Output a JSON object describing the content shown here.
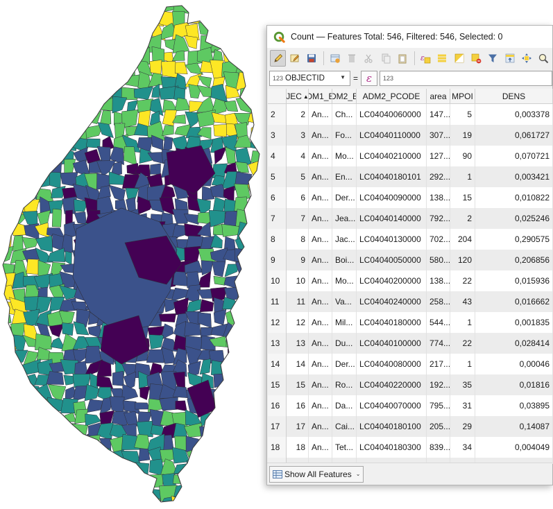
{
  "window": {
    "title": "Count — Features Total: 546, Filtered: 546, Selected: 0"
  },
  "toolbar": {
    "buttons": [
      {
        "icon": "pencil-icon",
        "name": "toggle-editing"
      },
      {
        "icon": "multi-edit-icon",
        "name": "multi-edit"
      },
      {
        "icon": "save-edits-icon",
        "name": "save-edits"
      },
      {
        "icon": "add-feature-icon",
        "name": "add-feature"
      },
      {
        "icon": "delete-icon",
        "name": "delete-features"
      },
      {
        "icon": "cut-icon",
        "name": "cut"
      },
      {
        "icon": "copy-icon",
        "name": "copy"
      },
      {
        "icon": "paste-icon",
        "name": "paste"
      },
      {
        "icon": "expression-select-icon",
        "name": "select-by-expression"
      },
      {
        "icon": "select-all-icon",
        "name": "select-all"
      },
      {
        "icon": "invert-selection-icon",
        "name": "invert-selection"
      },
      {
        "icon": "deselect-icon",
        "name": "deselect-all"
      },
      {
        "icon": "filter-icon",
        "name": "filter-select"
      },
      {
        "icon": "move-to-top-icon",
        "name": "move-selection-top"
      },
      {
        "icon": "pan-to-selected-icon",
        "name": "pan-to-selected"
      },
      {
        "icon": "zoom-icon",
        "name": "zoom-to-selected"
      }
    ]
  },
  "filter": {
    "field_type": "123",
    "field": "OBJECTID",
    "operator": "=",
    "expression_symbol": "ε",
    "value_placeholder": "123"
  },
  "table": {
    "columns": [
      "JEC",
      "DM1_E",
      "DM2_E",
      "ADM2_PCODE",
      "area",
      "MPOI",
      "DENS"
    ],
    "sort_indicator": "▲",
    "rows": [
      {
        "n": "2",
        "oid": "2",
        "adm1": "An...",
        "adm2": "Ch...",
        "pcode": "LC04040060000",
        "area": "147...",
        "mpoi": "5",
        "dens": "0,003378"
      },
      {
        "n": "3",
        "oid": "3",
        "adm1": "An...",
        "adm2": "Fo...",
        "pcode": "LC04040110000",
        "area": "307...",
        "mpoi": "19",
        "dens": "0,061727"
      },
      {
        "n": "4",
        "oid": "4",
        "adm1": "An...",
        "adm2": "Mo...",
        "pcode": "LC04040210000",
        "area": "127...",
        "mpoi": "90",
        "dens": "0,070721"
      },
      {
        "n": "5",
        "oid": "5",
        "adm1": "An...",
        "adm2": "En...",
        "pcode": "LC04040180101",
        "area": "292...",
        "mpoi": "1",
        "dens": "0,003421"
      },
      {
        "n": "6",
        "oid": "6",
        "adm1": "An...",
        "adm2": "Der...",
        "pcode": "LC04040090000",
        "area": "138...",
        "mpoi": "15",
        "dens": "0,010822"
      },
      {
        "n": "7",
        "oid": "7",
        "adm1": "An...",
        "adm2": "Jea...",
        "pcode": "LC04040140000",
        "area": "792...",
        "mpoi": "2",
        "dens": "0,025246"
      },
      {
        "n": "8",
        "oid": "8",
        "adm1": "An...",
        "adm2": "Jac...",
        "pcode": "LC04040130000",
        "area": "702...",
        "mpoi": "204",
        "dens": "0,290575"
      },
      {
        "n": "9",
        "oid": "9",
        "adm1": "An...",
        "adm2": "Boi...",
        "pcode": "LC04040050000",
        "area": "580...",
        "mpoi": "120",
        "dens": "0,206856"
      },
      {
        "n": "10",
        "oid": "10",
        "adm1": "An...",
        "adm2": "Mo...",
        "pcode": "LC04040200000",
        "area": "138...",
        "mpoi": "22",
        "dens": "0,015936"
      },
      {
        "n": "11",
        "oid": "11",
        "adm1": "An...",
        "adm2": "Va...",
        "pcode": "LC04040240000",
        "area": "258...",
        "mpoi": "43",
        "dens": "0,016662"
      },
      {
        "n": "12",
        "oid": "12",
        "adm1": "An...",
        "adm2": "Mil...",
        "pcode": "LC04040180000",
        "area": "544...",
        "mpoi": "1",
        "dens": "0,001835"
      },
      {
        "n": "13",
        "oid": "13",
        "adm1": "An...",
        "adm2": "Du...",
        "pcode": "LC04040100000",
        "area": "774...",
        "mpoi": "22",
        "dens": "0,028414"
      },
      {
        "n": "14",
        "oid": "14",
        "adm1": "An...",
        "adm2": "Der...",
        "pcode": "LC04040080000",
        "area": "217...",
        "mpoi": "1",
        "dens": "0,00046"
      },
      {
        "n": "15",
        "oid": "15",
        "adm1": "An...",
        "adm2": "Ro...",
        "pcode": "LC04040220000",
        "area": "192...",
        "mpoi": "35",
        "dens": "0,01816"
      },
      {
        "n": "16",
        "oid": "16",
        "adm1": "An...",
        "adm2": "Da...",
        "pcode": "LC04040070000",
        "area": "795...",
        "mpoi": "31",
        "dens": "0,03895"
      },
      {
        "n": "17",
        "oid": "17",
        "adm1": "An...",
        "adm2": "Cai...",
        "pcode": "LC04040180100",
        "area": "205...",
        "mpoi": "29",
        "dens": "0,14087"
      },
      {
        "n": "18",
        "oid": "18",
        "adm1": "An...",
        "adm2": "Tet...",
        "pcode": "LC04040180300",
        "area": "839...",
        "mpoi": "34",
        "dens": "0,004049"
      },
      {
        "n": "",
        "oid": "",
        "adm1": "",
        "adm2": "",
        "pcode": "",
        "area": "",
        "mpoi": "",
        "dens": ""
      }
    ]
  },
  "bottom": {
    "show_label": "Show All Features",
    "arrow": "⌄"
  },
  "map": {
    "colors": [
      "#440154",
      "#3b528b",
      "#21918c",
      "#5ec962",
      "#fde725"
    ]
  }
}
